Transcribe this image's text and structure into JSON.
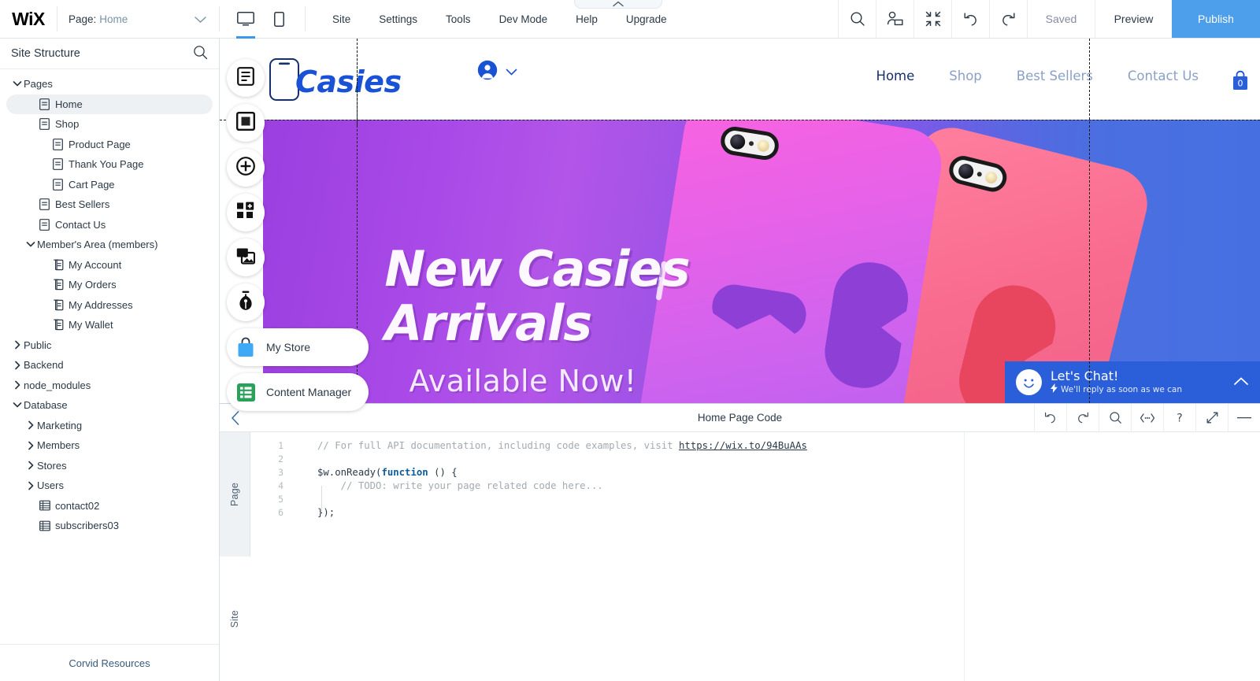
{
  "topbar": {
    "brand": "WiX",
    "page_label": "Page:",
    "page_value": "Home",
    "menus": [
      "Site",
      "Settings",
      "Tools",
      "Dev Mode",
      "Help",
      "Upgrade"
    ],
    "devices": [
      {
        "name": "desktop-view",
        "icon": "monitor-icon",
        "active": true
      },
      {
        "name": "mobile-view",
        "icon": "phone-icon",
        "active": false
      }
    ],
    "icons": [
      {
        "name": "search-icon"
      },
      {
        "name": "user-roles-icon"
      },
      {
        "name": "zoom-out-icon"
      },
      {
        "name": "undo-icon"
      },
      {
        "name": "redo-icon"
      }
    ],
    "saved_label": "Saved",
    "preview_label": "Preview",
    "publish_label": "Publish",
    "publish_color": "#4d9eeb"
  },
  "sidebar": {
    "title": "Site Structure",
    "search_icon": "search-icon",
    "footer_link": "Corvid Resources",
    "tree": [
      {
        "label": "Pages",
        "depth": 0,
        "twisty": "down",
        "icon": "none",
        "selected": false
      },
      {
        "label": "Home",
        "depth": 1,
        "twisty": "none",
        "icon": "page-icon",
        "selected": true
      },
      {
        "label": "Shop",
        "depth": 1,
        "twisty": "none",
        "icon": "page-icon",
        "selected": false
      },
      {
        "label": "Product Page",
        "depth": 2,
        "twisty": "none",
        "icon": "page-icon",
        "selected": false
      },
      {
        "label": "Thank You Page",
        "depth": 2,
        "twisty": "none",
        "icon": "page-icon",
        "selected": false
      },
      {
        "label": "Cart Page",
        "depth": 2,
        "twisty": "none",
        "icon": "page-icon",
        "selected": false
      },
      {
        "label": "Best Sellers",
        "depth": 1,
        "twisty": "none",
        "icon": "page-icon",
        "selected": false
      },
      {
        "label": "Contact Us",
        "depth": 1,
        "twisty": "none",
        "icon": "page-icon",
        "selected": false
      },
      {
        "label": "Member's Area (members)",
        "depth": 1,
        "twisty": "down",
        "icon": "none",
        "selected": false
      },
      {
        "label": "My Account",
        "depth": 2,
        "twisty": "none",
        "icon": "pages-stack-icon",
        "selected": false
      },
      {
        "label": "My Orders",
        "depth": 2,
        "twisty": "none",
        "icon": "pages-stack-icon",
        "selected": false
      },
      {
        "label": "My Addresses",
        "depth": 2,
        "twisty": "none",
        "icon": "pages-stack-icon",
        "selected": false
      },
      {
        "label": "My Wallet",
        "depth": 2,
        "twisty": "none",
        "icon": "pages-stack-icon",
        "selected": false
      },
      {
        "label": "Public",
        "depth": 0,
        "twisty": "right",
        "icon": "none",
        "selected": false
      },
      {
        "label": "Backend",
        "depth": 0,
        "twisty": "right",
        "icon": "none",
        "selected": false
      },
      {
        "label": "node_modules",
        "depth": 0,
        "twisty": "right",
        "icon": "none",
        "selected": false
      },
      {
        "label": "Database",
        "depth": 0,
        "twisty": "down",
        "icon": "none",
        "selected": false
      },
      {
        "label": "Marketing",
        "depth": 1,
        "twisty": "right",
        "icon": "none",
        "selected": false
      },
      {
        "label": "Members",
        "depth": 1,
        "twisty": "right",
        "icon": "none",
        "selected": false
      },
      {
        "label": "Stores",
        "depth": 1,
        "twisty": "right",
        "icon": "none",
        "selected": false
      },
      {
        "label": "Users",
        "depth": 1,
        "twisty": "right",
        "icon": "none",
        "selected": false
      },
      {
        "label": "contact02",
        "depth": 1,
        "twisty": "none",
        "icon": "table-icon",
        "selected": false
      },
      {
        "label": "subscribers03",
        "depth": 1,
        "twisty": "none",
        "icon": "table-icon",
        "selected": false
      }
    ]
  },
  "left_toolbar": [
    {
      "name": "menus-pages-button",
      "icon": "menus-pages-icon",
      "label": ""
    },
    {
      "name": "background-button",
      "icon": "background-icon",
      "label": ""
    },
    {
      "name": "add-button",
      "icon": "plus-icon",
      "label": ""
    },
    {
      "name": "add-apps-button",
      "icon": "apps-icon",
      "label": ""
    },
    {
      "name": "media-button",
      "icon": "media-icon",
      "label": ""
    },
    {
      "name": "blog-button",
      "icon": "pen-icon",
      "label": ""
    },
    {
      "name": "my-store-button",
      "icon": "store-bag-icon",
      "label": "My Store"
    },
    {
      "name": "content-manager-button",
      "icon": "content-manager-icon",
      "label": "Content Manager"
    }
  ],
  "site": {
    "logo_text": "Casies",
    "logo_color": "#1a52d6",
    "account_icon": "account-avatar-icon",
    "nav": [
      {
        "label": "Home",
        "current": true
      },
      {
        "label": "Shop",
        "current": false
      },
      {
        "label": "Best Sellers",
        "current": false
      },
      {
        "label": "Contact Us",
        "current": false
      }
    ],
    "cart": {
      "icon": "cart-bag-icon",
      "count": "0"
    },
    "hero": {
      "title": "New Casies\nArrivals",
      "subtitle": "Available Now!",
      "gradient_from": "#9b3fe0",
      "gradient_to": "#4a6fe0"
    },
    "chat": {
      "title": "Let's Chat!",
      "subtitle": "We'll reply as soon as we can",
      "bolt_icon": "bolt-icon",
      "collapse_icon": "chevron-up-icon",
      "avatar_icon": "smiley-icon",
      "color": "#2b5fd9"
    }
  },
  "code_panel": {
    "back_icon": "chevron-left-icon",
    "title": "Home Page Code",
    "tools": [
      {
        "name": "undo-icon"
      },
      {
        "name": "redo-icon"
      },
      {
        "name": "search-icon"
      },
      {
        "name": "code-snippet-icon"
      },
      {
        "name": "help-icon"
      },
      {
        "name": "expand-icon"
      },
      {
        "name": "minimize-icon"
      }
    ],
    "tabs": [
      {
        "label": "Page",
        "active": false
      },
      {
        "label": "Site",
        "active": true
      }
    ],
    "line_numbers": [
      "1",
      "2",
      "3",
      "4",
      "5",
      "6"
    ],
    "lines": [
      {
        "type": "comment_link",
        "text": "// For full API documentation, including code examples, visit ",
        "link": "https://wix.to/94BuAAs"
      },
      {
        "type": "blank",
        "text": ""
      },
      {
        "type": "code",
        "pre": "$w.onReady(",
        "kw": "function",
        "post": " () {"
      },
      {
        "type": "comment_indent",
        "text": "// TODO: write your page related code here..."
      },
      {
        "type": "blank",
        "text": ""
      },
      {
        "type": "code_plain",
        "text": "});"
      }
    ]
  }
}
